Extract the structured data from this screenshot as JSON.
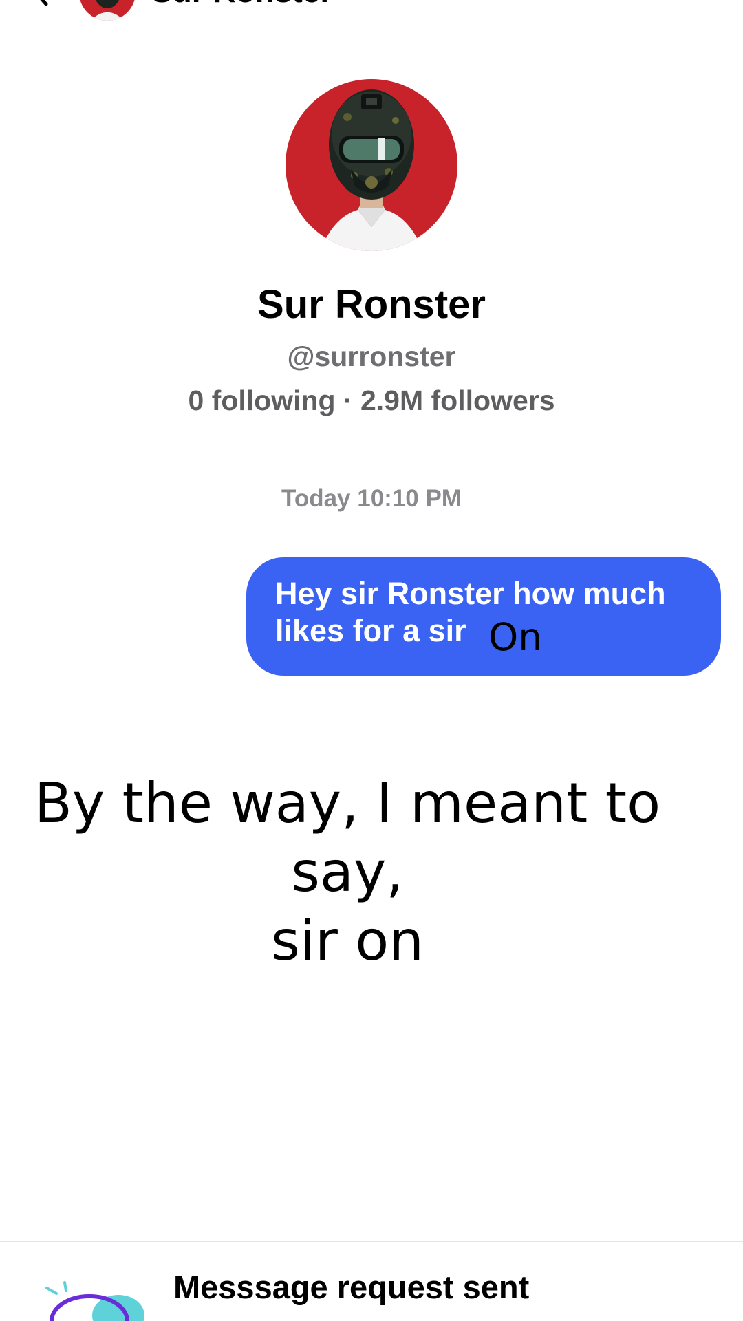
{
  "header": {
    "name": "Sur Ronster"
  },
  "profile": {
    "name": "Sur Ronster",
    "handle": "@surronster",
    "stats": "0 following · 2.9M followers"
  },
  "conversation": {
    "timestamp": "Today 10:10 PM",
    "messages": [
      {
        "direction": "outgoing",
        "text": "Hey sir Ronster how much likes for a sir"
      }
    ],
    "overlay_word": "On"
  },
  "caption": {
    "line1": "By the way, I meant to say,",
    "line2": "sir on"
  },
  "banner": {
    "title": "Messsage request sent"
  },
  "colors": {
    "bubble": "#3a63f3",
    "avatar_background": "#c8232a",
    "icon_accent": "#5ed1d9",
    "icon_outline": "#6a2bd8"
  }
}
